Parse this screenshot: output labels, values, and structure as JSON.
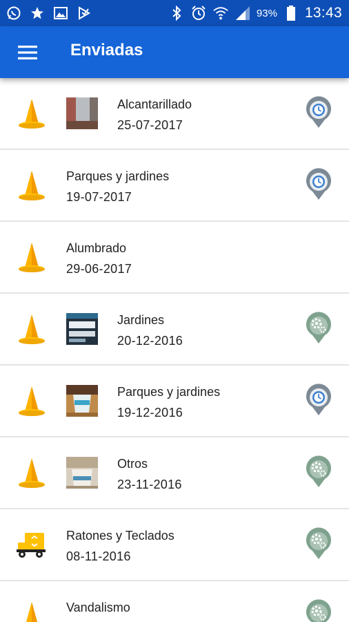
{
  "status_bar": {
    "left_icons": [
      "whatsapp-icon",
      "star-icon",
      "image-icon",
      "play-store-icon"
    ],
    "right_icons": [
      "bluetooth-icon",
      "alarm-icon",
      "wifi-icon",
      "signal-icon",
      "battery-icon"
    ],
    "battery": "93%",
    "time": "13:43"
  },
  "app_bar": {
    "title": "Enviadas",
    "menu_icon": "menu-icon"
  },
  "colors": {
    "status_bar": "#0e4fb7",
    "app_bar": "#1565d8",
    "cone": "#ffb300",
    "status_blue_gray": "#7d8a96",
    "status_green_gray": "#7fa28e"
  },
  "items": [
    {
      "category": "Alcantarillado",
      "date": "25-07-2017",
      "icon": "cone-icon",
      "thumb": "photo-red",
      "status": "clock-status-icon"
    },
    {
      "category": "Parques y jardines",
      "date": "19-07-2017",
      "icon": "cone-icon",
      "thumb": "",
      "status": "clock-status-icon"
    },
    {
      "category": "Alumbrado",
      "date": "29-06-2017",
      "icon": "cone-icon",
      "thumb": "",
      "status": ""
    },
    {
      "category": "Jardines",
      "date": "20-12-2016",
      "icon": "cone-icon",
      "thumb": "photo-screen",
      "status": "gear-status-icon"
    },
    {
      "category": "Parques y jardines",
      "date": "19-12-2016",
      "icon": "cone-icon",
      "thumb": "photo-cup",
      "status": "clock-status-icon"
    },
    {
      "category": "Otros",
      "date": "23-11-2016",
      "icon": "cone-icon",
      "thumb": "photo-light",
      "status": "gear-status-icon"
    },
    {
      "category": "Ratones y Teclados",
      "date": "08-11-2016",
      "icon": "recycle-truck-icon",
      "thumb": "",
      "status": "gear-status-icon"
    },
    {
      "category": "Vandalismo",
      "date": "",
      "icon": "cone-icon",
      "thumb": "",
      "status": "gear-status-icon"
    }
  ]
}
